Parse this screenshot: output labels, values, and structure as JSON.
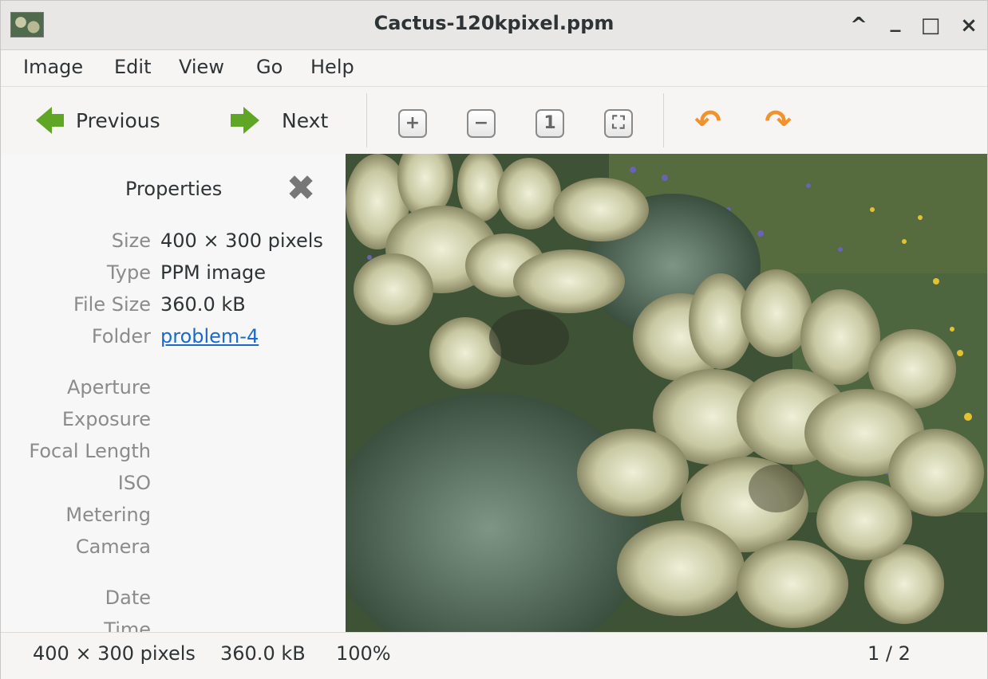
{
  "window": {
    "title": "Cactus-120kpixel.ppm",
    "controls": [
      "^",
      "_",
      "□",
      "×"
    ]
  },
  "menu": [
    "Image",
    "Edit",
    "View",
    "Go",
    "Help"
  ],
  "toolbar": {
    "previous_label": "Previous",
    "next_label": "Next",
    "zoom_in_glyph": "+",
    "zoom_out_glyph": "−",
    "normal_size_glyph": "1",
    "fit_glyph": "⛶",
    "rotate_left_glyph": "↶",
    "rotate_right_glyph": "↷"
  },
  "sidebar": {
    "title": "Properties",
    "close_glyph": "✖",
    "properties": [
      {
        "label": "Size",
        "value": "400 × 300 pixels"
      },
      {
        "label": "Type",
        "value": "PPM image"
      },
      {
        "label": "File Size",
        "value": "360.0 kB"
      },
      {
        "label": "Folder",
        "value": "problem-4"
      }
    ],
    "exif_labels": [
      "Aperture",
      "Exposure",
      "Focal Length",
      "ISO",
      "Metering",
      "Camera"
    ],
    "date_labels": [
      "Date",
      "Time"
    ]
  },
  "statusbar": {
    "dimensions": "400 × 300 pixels",
    "filesize": "360.0 kB",
    "zoom": "100%",
    "position": "1 / 2"
  },
  "colors": {
    "accent_link": "#1b6acb",
    "nav_arrow": "#5fa626",
    "rotate_arrow": "#f3922b"
  }
}
